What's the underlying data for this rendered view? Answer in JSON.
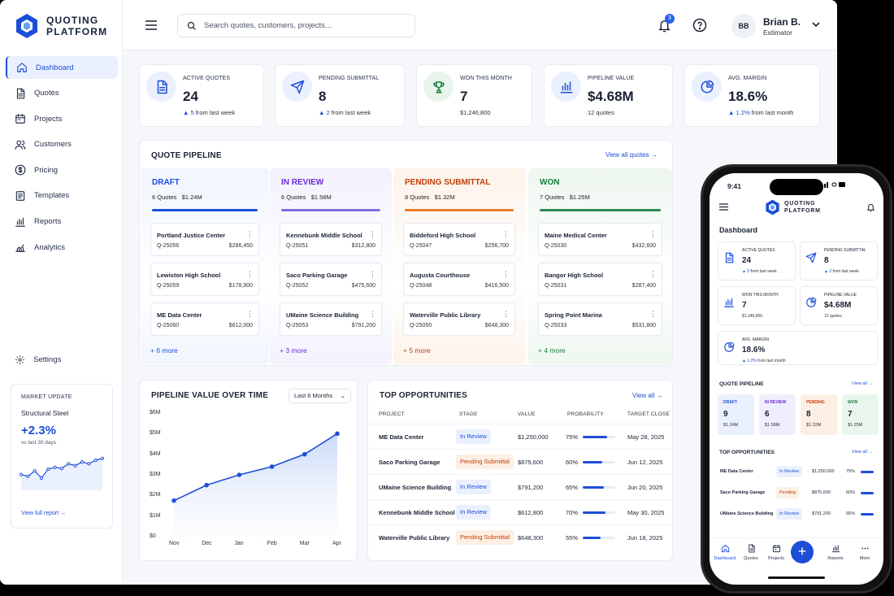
{
  "brand": {
    "line1": "QUOTING",
    "line2": "PLATFORM",
    "color": "#1d4ed8"
  },
  "nav": [
    {
      "label": "Dashboard",
      "icon": "home-icon",
      "active": true
    },
    {
      "label": "Quotes",
      "icon": "document-icon"
    },
    {
      "label": "Projects",
      "icon": "calendar-icon"
    },
    {
      "label": "Customers",
      "icon": "users-icon"
    },
    {
      "label": "Pricing",
      "icon": "dollar-icon"
    },
    {
      "label": "Templates",
      "icon": "template-icon"
    },
    {
      "label": "Reports",
      "icon": "bar-chart-icon"
    },
    {
      "label": "Analytics",
      "icon": "analytics-icon"
    }
  ],
  "settings_label": "Settings",
  "market": {
    "label": "MARKET UPDATE",
    "name": "Structural Steel",
    "change": "+2.3%",
    "sub": "vs last 30 days",
    "link": "View full report",
    "trend": [
      0.35,
      0.3,
      0.45,
      0.25,
      0.5,
      0.55,
      0.52,
      0.65,
      0.6,
      0.7,
      0.65,
      0.75,
      0.8
    ]
  },
  "search": {
    "placeholder": "Search quotes, customers, projects..."
  },
  "notifications": {
    "count": "3"
  },
  "user": {
    "initials": "BB",
    "name": "Brian B.",
    "role": "Estimator"
  },
  "stats": [
    {
      "title": "ACTIVE QUOTES",
      "value": "24",
      "delta": "5",
      "delta_text": "from last week",
      "icon": "document-icon",
      "bg": "#eaf0fd",
      "fg": "#1d4ed8"
    },
    {
      "title": "PENDING SUBMITTAL",
      "value": "8",
      "delta": "2",
      "delta_text": "from last week",
      "icon": "send-icon",
      "bg": "#eaf0fd",
      "fg": "#1d4ed8"
    },
    {
      "title": "WON THIS MONTH",
      "value": "7",
      "sub": "$1,246,800",
      "icon": "trophy-icon",
      "bg": "#e8f5ec",
      "fg": "#15803d"
    },
    {
      "title": "PIPELINE VALUE",
      "value": "$4.68M",
      "sub": "12 quotes",
      "icon": "bar-chart-icon",
      "bg": "#eaf0fd",
      "fg": "#1d4ed8"
    },
    {
      "title": "AVG. MARGIN",
      "value": "18.6%",
      "delta": "1.2%",
      "delta_text": "from last month",
      "icon": "pie-icon",
      "bg": "#eaf0fd",
      "fg": "#1d4ed8"
    }
  ],
  "pipeline": {
    "title": "QUOTE PIPELINE",
    "link": "View all quotes",
    "columns": [
      {
        "name": "DRAFT",
        "count": "6 Quotes",
        "value": "$1.24M",
        "color": "#1d4ed8",
        "bg": "#f1f5fe",
        "bar": "#1d4ed8",
        "more": "+ 6 more",
        "cards": [
          {
            "name": "Portland Justice Center",
            "id": "Q-25056",
            "amount": "$286,450"
          },
          {
            "name": "Lewiston High School",
            "id": "Q-25059",
            "amount": "$178,900"
          },
          {
            "name": "ME Data Center",
            "id": "Q-25060",
            "amount": "$612,000"
          }
        ]
      },
      {
        "name": "IN REVIEW",
        "count": "6 Quotes",
        "value": "$1.58M",
        "color": "#6d28d9",
        "bg": "#f3f2fd",
        "bar": "#7c6fdc",
        "more": "+ 3 more",
        "cards": [
          {
            "name": "Kennebunk Middle School",
            "id": "Q-25051",
            "amount": "$312,800"
          },
          {
            "name": "Saco Parking Garage",
            "id": "Q-25052",
            "amount": "$475,600"
          },
          {
            "name": "UMaine Science Building",
            "id": "Q-25053",
            "amount": "$791,200"
          }
        ]
      },
      {
        "name": "PENDING SUBMITTAL",
        "count": "8 Quotes",
        "value": "$1.32M",
        "color": "#c2410c",
        "bg": "#fdf3ea",
        "bar": "#ea7c2b",
        "more": "+ 5 more",
        "cards": [
          {
            "name": "Biddeford High School",
            "id": "Q-25047",
            "amount": "$256,700"
          },
          {
            "name": "Augusta Courthouse",
            "id": "Q-25048",
            "amount": "$416,500"
          },
          {
            "name": "Waterville Public Library",
            "id": "Q-25050",
            "amount": "$648,300"
          }
        ]
      },
      {
        "name": "WON",
        "count": "7 Quotes",
        "value": "$1.25M",
        "color": "#15803d",
        "bg": "#eef7f0",
        "bar": "#2f8a4f",
        "more": "+ 4 more",
        "cards": [
          {
            "name": "Maine Medical Center",
            "id": "Q-25030",
            "amount": "$432,600"
          },
          {
            "name": "Bangor High School",
            "id": "Q-25031",
            "amount": "$287,400"
          },
          {
            "name": "Spring Point Marina",
            "id": "Q-25033",
            "amount": "$531,800"
          }
        ]
      }
    ]
  },
  "value_chart": {
    "title": "PIPELINE VALUE OVER TIME",
    "range_label": "Last 6 Months",
    "chart_data": {
      "type": "area",
      "categories": [
        "Nov",
        "Dec",
        "Jan",
        "Feb",
        "Mar",
        "Apr"
      ],
      "values": [
        1.75,
        2.5,
        3.0,
        3.4,
        4.0,
        5.0
      ],
      "yticks": [
        "$0",
        "$1M",
        "$2M",
        "$3M",
        "$4M",
        "$5M",
        "$6M"
      ],
      "ylim": [
        0,
        6
      ],
      "color": "#1d4ed8"
    }
  },
  "opportunities": {
    "title": "TOP OPPORTUNITIES",
    "link": "View all",
    "headers": [
      "PROJECT",
      "STAGE",
      "VALUE",
      "PROBABILITY",
      "TARGET CLOSE"
    ],
    "rows": [
      {
        "project": "ME Data Center",
        "stage": "In Review",
        "value": "$1,250,000",
        "probability": "75%",
        "prob": 0.75,
        "close": "May 28, 2025",
        "kind": "review"
      },
      {
        "project": "Saco Parking Garage",
        "stage": "Pending Submittal",
        "value": "$875,600",
        "probability": "60%",
        "prob": 0.6,
        "close": "Jun 12, 2025",
        "kind": "pending"
      },
      {
        "project": "UMaine Science Building",
        "stage": "In Review",
        "value": "$791,200",
        "probability": "65%",
        "prob": 0.65,
        "close": "Jun 20, 2025",
        "kind": "review"
      },
      {
        "project": "Kennebunk Middle School",
        "stage": "In Review",
        "value": "$612,800",
        "probability": "70%",
        "prob": 0.7,
        "close": "May 30, 2025",
        "kind": "review"
      },
      {
        "project": "Waterville Public Library",
        "stage": "Pending Submittal",
        "value": "$648,300",
        "probability": "55%",
        "prob": 0.55,
        "close": "Jun 18, 2025",
        "kind": "pending"
      }
    ]
  },
  "mobile": {
    "time": "9:41",
    "title": "Dashboard",
    "cards": [
      {
        "title": "ACTIVE QUOTES",
        "value": "24",
        "delta": "5",
        "delta_text": "from last week",
        "icon": "document-icon"
      },
      {
        "title": "PENDING SUBMITTAL",
        "value": "8",
        "delta": "2",
        "delta_text": "from last week",
        "icon": "send-icon"
      },
      {
        "title": "WON THIS MONTH",
        "value": "7",
        "sub": "$1,246,800",
        "icon": "bar-chart-icon"
      },
      {
        "title": "PIPELINE VALUE",
        "value": "$4.68M",
        "sub": "12 quotes",
        "icon": "pie-icon"
      },
      {
        "title": "AVG. MARGIN",
        "value": "18.6%",
        "delta": "1.2%",
        "delta_text": "from last month",
        "icon": "pie-icon"
      }
    ],
    "pipeline_title": "QUOTE PIPELINE",
    "pipeline_link": "View all",
    "pipeline": [
      {
        "name": "DRAFT",
        "count": "9",
        "value": "$1.24M",
        "color": "#1d4ed8",
        "bg": "#eaf0fd"
      },
      {
        "name": "IN REVIEW",
        "count": "6",
        "value": "$1.58M",
        "color": "#6d28d9",
        "bg": "#f0eefc"
      },
      {
        "name": "PENDING",
        "count": "8",
        "value": "$1.32M",
        "color": "#c2410c",
        "bg": "#fdefe3"
      },
      {
        "name": "WON",
        "count": "7",
        "value": "$1.25M",
        "color": "#15803d",
        "bg": "#e9f6ed"
      }
    ],
    "opp_title": "TOP OPPORTUNITIES",
    "opp_link": "View all",
    "opps": [
      {
        "project": "ME Data Center",
        "stage": "In Review",
        "value": "$1,250,000",
        "probability": "75%",
        "kind": "review"
      },
      {
        "project": "Saco Parking Garage",
        "stage": "Pending",
        "value": "$875,600",
        "probability": "60%",
        "kind": "pending"
      },
      {
        "project": "UMaine Science Building",
        "stage": "In Review",
        "value": "$791,200",
        "probability": "65%",
        "kind": "review"
      }
    ],
    "tabs": [
      "Dashboard",
      "Quotes",
      "Projects",
      "Reports",
      "More"
    ]
  }
}
